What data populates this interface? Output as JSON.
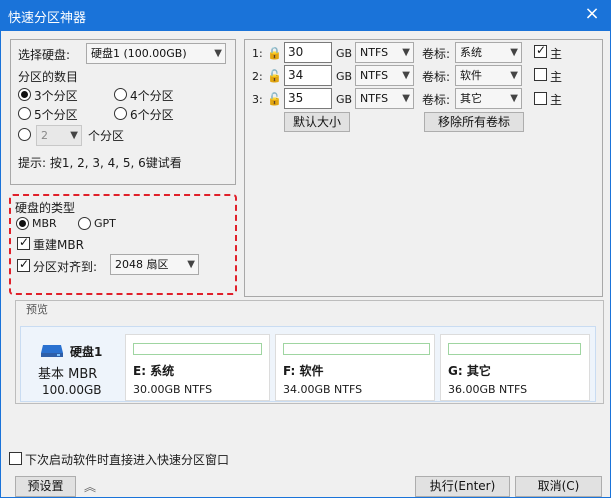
{
  "window": {
    "title": "快速分区神器",
    "close_label": "×"
  },
  "disk": {
    "label": "选择硬盘:",
    "selected": "硬盘1 (100.00GB)"
  },
  "partitions": {
    "count_label": "分区的数目",
    "options": [
      "3个分区",
      "4个分区",
      "5个分区",
      "6个分区"
    ],
    "custom_value": "2",
    "custom_suffix": "个分区",
    "selected_index": 0,
    "hint": "提示: 按1, 2, 3, 4, 5, 6键试看"
  },
  "disk_type": {
    "title": "硬盘的类型",
    "mbr": "MBR",
    "gpt": "GPT",
    "rebuild_mbr": "重建MBR",
    "align_label": "分区对齐到:",
    "align_value": "2048 扇区"
  },
  "rows": [
    {
      "index": "1:",
      "size": "30",
      "unit": "GB",
      "fs": "NTFS",
      "label_text": "卷标:",
      "volume": "系统",
      "primary": "主",
      "primary_checked": true,
      "locked": true
    },
    {
      "index": "2:",
      "size": "34",
      "unit": "GB",
      "fs": "NTFS",
      "label_text": "卷标:",
      "volume": "软件",
      "primary": "主",
      "primary_checked": false,
      "locked": false
    },
    {
      "index": "3:",
      "size": "35",
      "unit": "GB",
      "fs": "NTFS",
      "label_text": "卷标:",
      "volume": "其它",
      "primary": "主",
      "primary_checked": false,
      "locked": false
    }
  ],
  "actions": {
    "default_size": "默认大小",
    "remove_labels": "移除所有卷标"
  },
  "preview": {
    "title": "预览",
    "disk_name": "硬盘1",
    "disk_type": "基本 MBR",
    "disk_size": "100.00GB",
    "parts": [
      {
        "name": "E: 系统",
        "detail": "30.00GB NTFS"
      },
      {
        "name": "F: 软件",
        "detail": "34.00GB NTFS"
      },
      {
        "name": "G: 其它",
        "detail": "36.00GB NTFS"
      }
    ]
  },
  "footer": {
    "startup_label": "下次启动软件时直接进入快速分区窗口",
    "preset": "预设置",
    "execute": "执行(Enter)",
    "cancel": "取消(C)"
  },
  "colors": {
    "title_bar": "#1a73d9",
    "highlight_border": "#e0202a",
    "preview_bar": "#9fd5a1",
    "disk_icon": "#2a71d0"
  }
}
